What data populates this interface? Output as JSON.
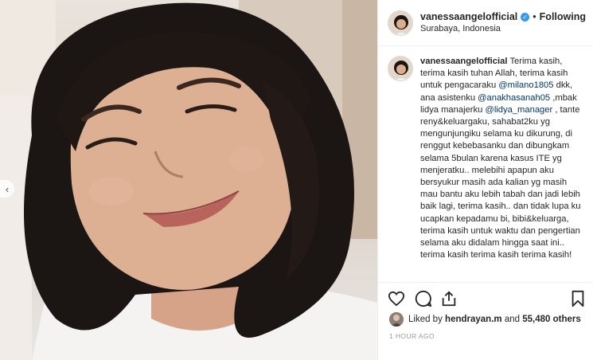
{
  "header": {
    "username": "vanessaangelofficial",
    "separator": "•",
    "follow_label": "Following",
    "location": "Surabaya, Indonesia"
  },
  "caption": {
    "username": "vanessaangelofficial",
    "t1": "Terima kasih, terima kasih tuhan Allah, terima kasih untuk pengacaraku ",
    "m1": "@milano1805",
    "t2": " dkk, ana asistenku ",
    "m2": "@anakhasanah05",
    "t3": " ,mbak lidya manajerku ",
    "m3": "@lidya_manager",
    "t4": " , tante reny&keluargaku, sahabat2ku yg mengunjungiku selama ku dikurung, di renggut kebebasanku dan dibungkam selama 5bulan karena kasus ITE yg menjeratku.. melebihi apapun aku bersyukur masih ada kalian yg masih mau bantu aku lebih tabah dan jadi lebih baik lagi, terima kasih.. dan tidak lupa ku ucapkan kepadamu bi, bibi&keluarga, terima kasih untuk waktu dan pengertian selama aku didalam hingga saat ini.. terima kasih terima kasih terima kasih!",
    "more": "..."
  },
  "actions": {
    "liked_by_prefix": "Liked by ",
    "liker": "hendrayan.m",
    "and": " and ",
    "others": "55,480 others",
    "timestamp": "1 HOUR AGO"
  },
  "colors": {
    "verified": "#3897f0",
    "mention": "#003569",
    "muted": "#999999",
    "border": "#efefef"
  }
}
